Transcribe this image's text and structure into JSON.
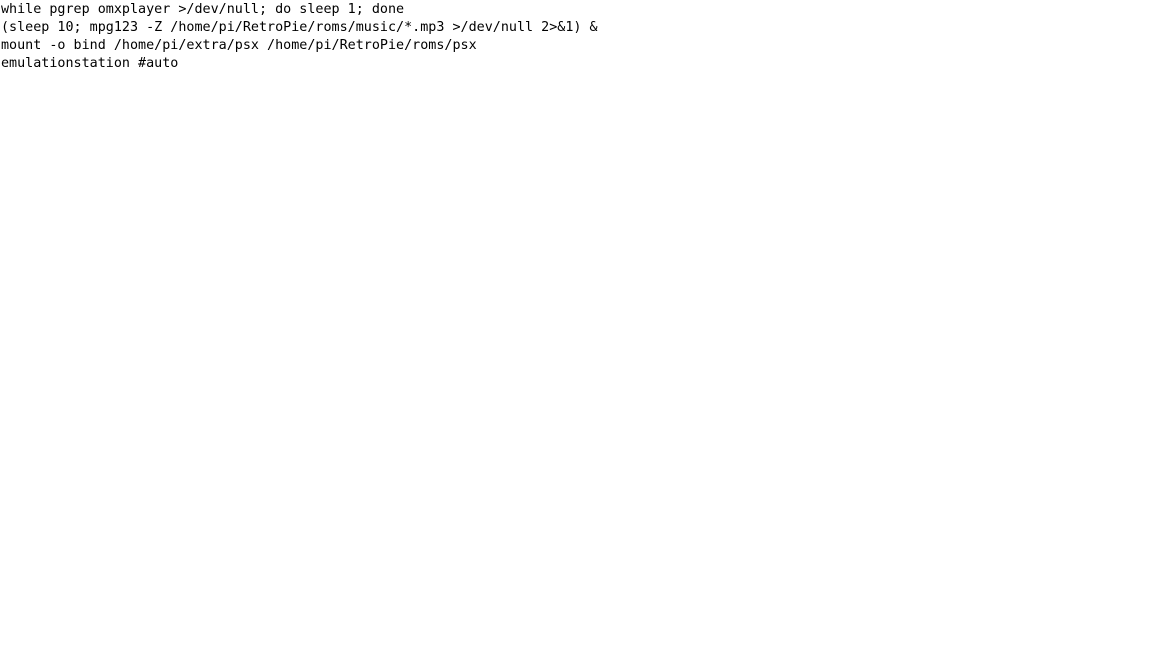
{
  "document": {
    "type": "plain-text-script",
    "background_color": "#ffffff",
    "text_color": "#000000",
    "font_kind": "monospace",
    "script": {
      "line_count": 4,
      "lines": [
        "while pgrep omxplayer >/dev/null; do sleep 1; done",
        "(sleep 10; mpg123 -Z /home/pi/RetroPie/roms/music/*.mp3 >/dev/null 2>&1) &",
        "mount -o bind /home/pi/extra/psx /home/pi/RetroPie/roms/psx",
        "emulationstation #auto"
      ]
    }
  }
}
